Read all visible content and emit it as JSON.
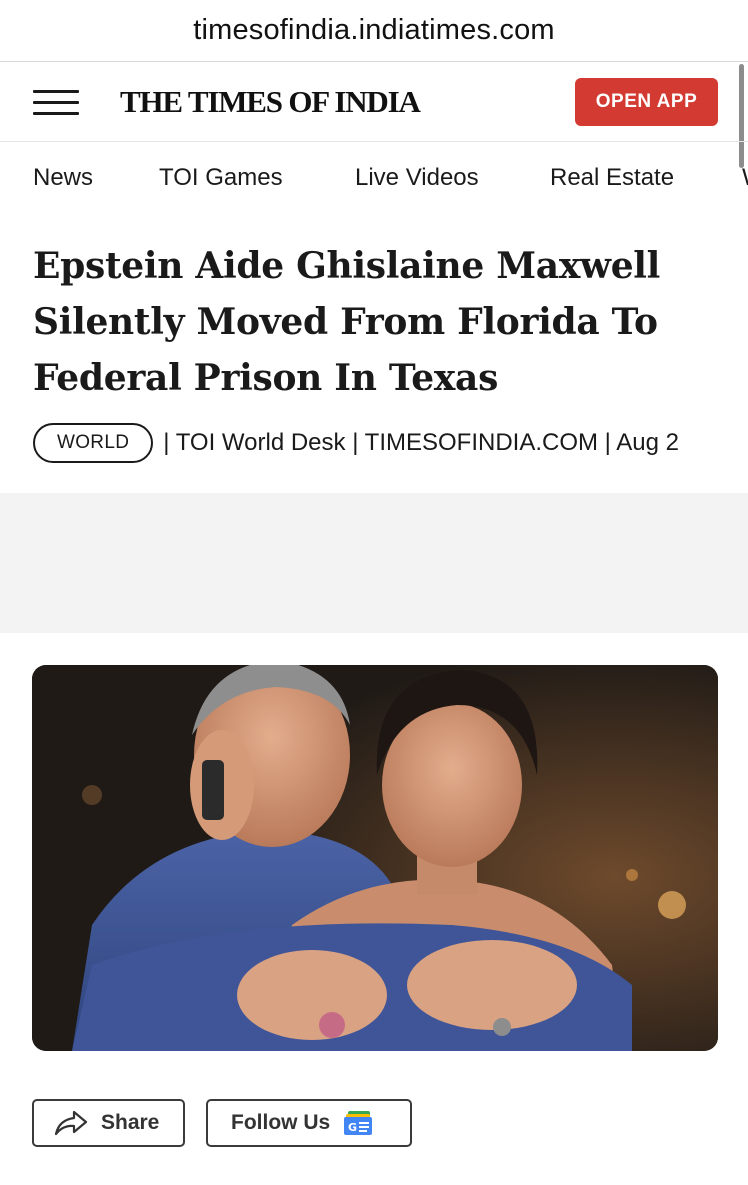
{
  "browser": {
    "url": "timesofindia.indiatimes.com"
  },
  "header": {
    "menu_icon": "hamburger-menu-icon",
    "logo_text": "THE TIMES OF INDIA",
    "open_app_label": "OPEN APP",
    "brand_color": "#d23a32"
  },
  "nav": {
    "items": [
      {
        "label": "News"
      },
      {
        "label": "TOI Games"
      },
      {
        "label": "Live Videos"
      },
      {
        "label": "Real Estate"
      },
      {
        "label": "W"
      }
    ]
  },
  "article": {
    "headline": "Epstein Aide Ghislaine Maxwell Silently Moved From Florida To Federal Prison In Texas",
    "category": "WORLD",
    "byline": "| TOI World Desk | TIMESOFINDIA.COM | Aug 2"
  },
  "actions": {
    "share_label": "Share",
    "share_icon": "share-arrow-icon",
    "follow_label": "Follow Us",
    "follow_icon": "google-news-icon"
  }
}
